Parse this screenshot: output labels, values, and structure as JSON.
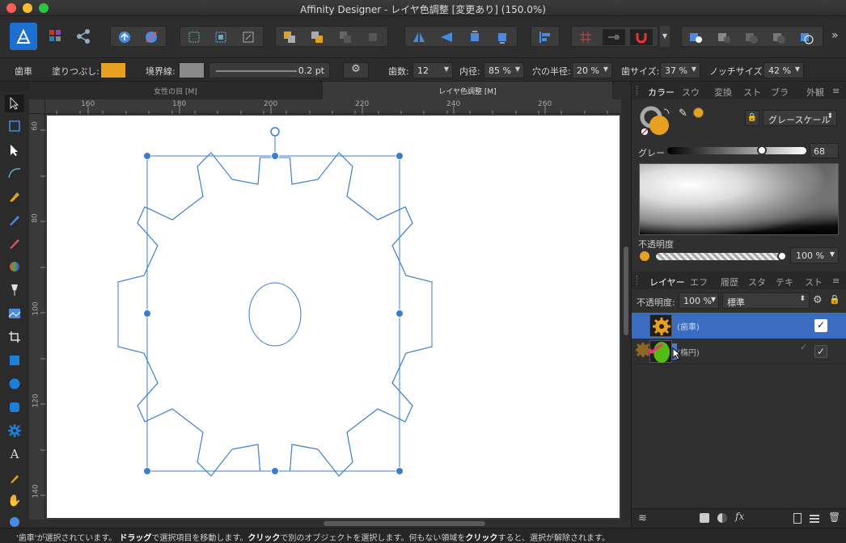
{
  "window": {
    "title": "Affinity Designer - レイヤ色調整 [変更あり] (150.0%)"
  },
  "colors": {
    "accent": "#3b82d8",
    "fill": "#e8a020",
    "green": "#55bb14",
    "selection": "#3a6cc0"
  },
  "context": {
    "object": "歯車",
    "fill_label": "塗りつぶし:",
    "stroke_label": "境界線:",
    "stroke_width": "0.2 pt",
    "teeth_label": "歯数:",
    "teeth": "12",
    "inner_label": "内径:",
    "inner": "85 %",
    "hole_label": "穴の半径:",
    "hole": "20 %",
    "tooth_size_label": "歯サイズ:",
    "tooth_size": "37 %",
    "notch_label": "ノッチサイズ:",
    "notch": "42 %"
  },
  "doc_tabs": [
    "女性の目 [M]",
    "レイヤ色調整 [M]"
  ],
  "ruler": {
    "top": [
      "160",
      "180",
      "200",
      "220",
      "240",
      "260"
    ],
    "left": [
      "60",
      "80",
      "100",
      "120",
      "140"
    ]
  },
  "color_panel": {
    "tabs": [
      "カラー",
      "スウ",
      "変換",
      "スト",
      "ブラ",
      "外観"
    ],
    "mode": "グレースケール",
    "gray_label": "グレー",
    "gray_value": "68",
    "opacity_label": "不透明度",
    "opacity_value": "100 %"
  },
  "layers_panel": {
    "tabs": [
      "レイヤー",
      "エフ",
      "履歴",
      "スタ",
      "テキ",
      "スト"
    ],
    "opacity_label": "不透明度:",
    "opacity_value": "100 %",
    "blend_mode": "標準",
    "layers": [
      {
        "name": "(歯車)",
        "selected": true,
        "visible": true
      },
      {
        "name": "(楕円)",
        "selected": false,
        "visible": true
      }
    ]
  },
  "status": {
    "part1": "'歯車'が選択されています。",
    "drag": "ドラッグ",
    "part2": "で選択項目を移動します。",
    "click1": "クリック",
    "part3": "で別のオブジェクトを選択します。何もない領域を",
    "click2": "クリック",
    "part4": "すると、選択が解除されます。"
  }
}
